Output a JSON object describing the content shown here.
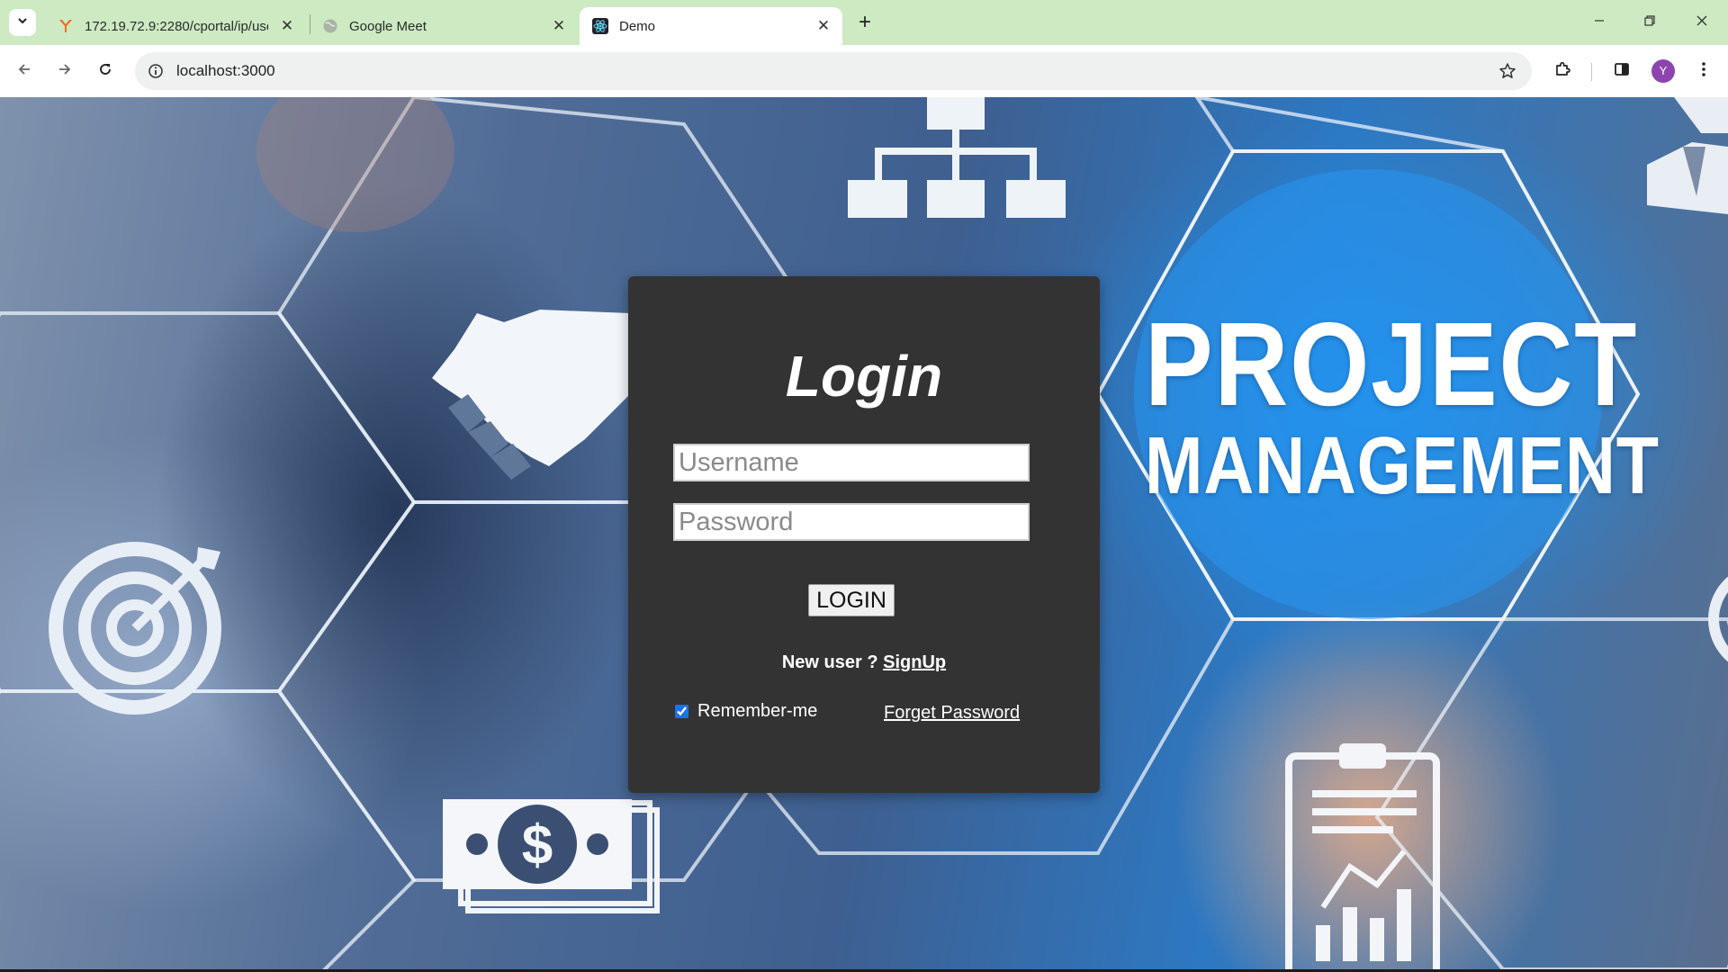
{
  "browser": {
    "tabs": [
      {
        "title": "172.19.72.9:2280/cportal/ip/use",
        "favicon": "yatra-logo-icon",
        "active": false
      },
      {
        "title": "Google Meet",
        "favicon": "globe-icon",
        "active": false
      },
      {
        "title": "Demo",
        "favicon": "react-icon",
        "active": true
      }
    ],
    "new_tab_label": "+",
    "address": "localhost:3000",
    "profile_initial": "Y",
    "accent_colors": {
      "tabstrip": "#cdeac3",
      "avatar": "#8e44ad"
    }
  },
  "background": {
    "headline_line1": "PROJECT",
    "headline_line2": "MANAGEMENT",
    "icons": [
      "org-chart-icon",
      "handshake-icon",
      "target-icon",
      "money-icon",
      "clipboard-chart-icon",
      "businessman-icon"
    ]
  },
  "login": {
    "title": "Login",
    "username_placeholder": "Username",
    "password_placeholder": "Password",
    "button_label": "LOGIN",
    "new_user_text": "New user ? ",
    "signup_link": "SignUp",
    "remember_label": "Remember-me",
    "remember_checked": true,
    "forget_link": "Forget Password",
    "card_color": "#333333"
  }
}
